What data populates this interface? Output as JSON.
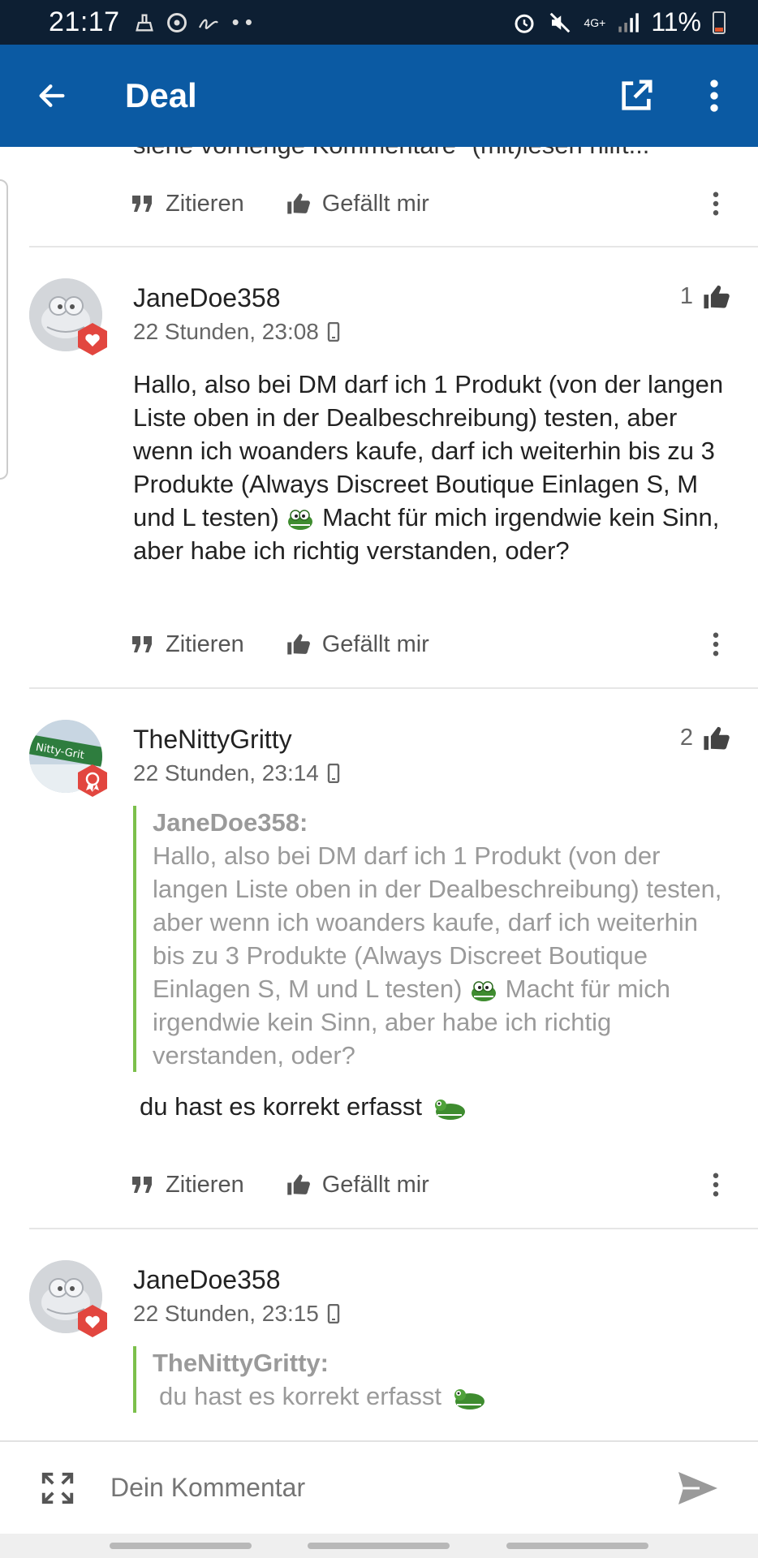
{
  "status_bar": {
    "time": "21:17",
    "network": "4G+",
    "battery": "11%"
  },
  "app_bar": {
    "title": "Deal"
  },
  "previous_comment": {
    "cutoff_text": "siehe vorherige Kommentare \"(mit)lesen hilft..."
  },
  "actions": {
    "quote_label": "Zitieren",
    "like_label": "Gefällt mir"
  },
  "comments": [
    {
      "username": "JaneDoe358",
      "time": "22 Stunden, 23:08",
      "likes": "1",
      "text_before_emoji": "Hallo, also bei DM darf ich 1 Produkt (von der langen Liste oben in der Dealbeschreibung) testen, aber wenn ich woanders kaufe, darf ich weiterhin bis zu 3 Produkte (Always Discreet Boutique Einlagen S, M und L testen)",
      "text_after_emoji": " Macht für mich irgendwie kein Sinn, aber habe ich richtig verstanden, oder?"
    },
    {
      "username": "TheNittyGritty",
      "time": "22 Stunden, 23:14",
      "likes": "2",
      "avatar_text": "Nitty-Grit",
      "quote_author": "JaneDoe358:",
      "quote_before_emoji": "Hallo, also bei DM darf ich 1 Produkt (von der langen Liste oben in der Dealbeschreibung) testen, aber wenn ich woanders kaufe, darf ich weiterhin bis zu 3 Produkte (Always Discreet Boutique Einlagen S, M und L testen)",
      "quote_after_emoji": " Macht für mich irgendwie kein Sinn, aber habe ich richtig verstanden, oder?",
      "reply": "du hast es korrekt erfasst"
    },
    {
      "username": "JaneDoe358",
      "time": "22 Stunden, 23:15",
      "quote_author": "TheNittyGritty:",
      "quote_text": "du hast es korrekt erfasst"
    }
  ],
  "comment_input": {
    "placeholder": "Dein Kommentar"
  },
  "colors": {
    "app_bar": "#0b5aa3",
    "status_bar": "#0d1f33",
    "quote_border": "#7cc04b",
    "badge": "#e2463f"
  }
}
